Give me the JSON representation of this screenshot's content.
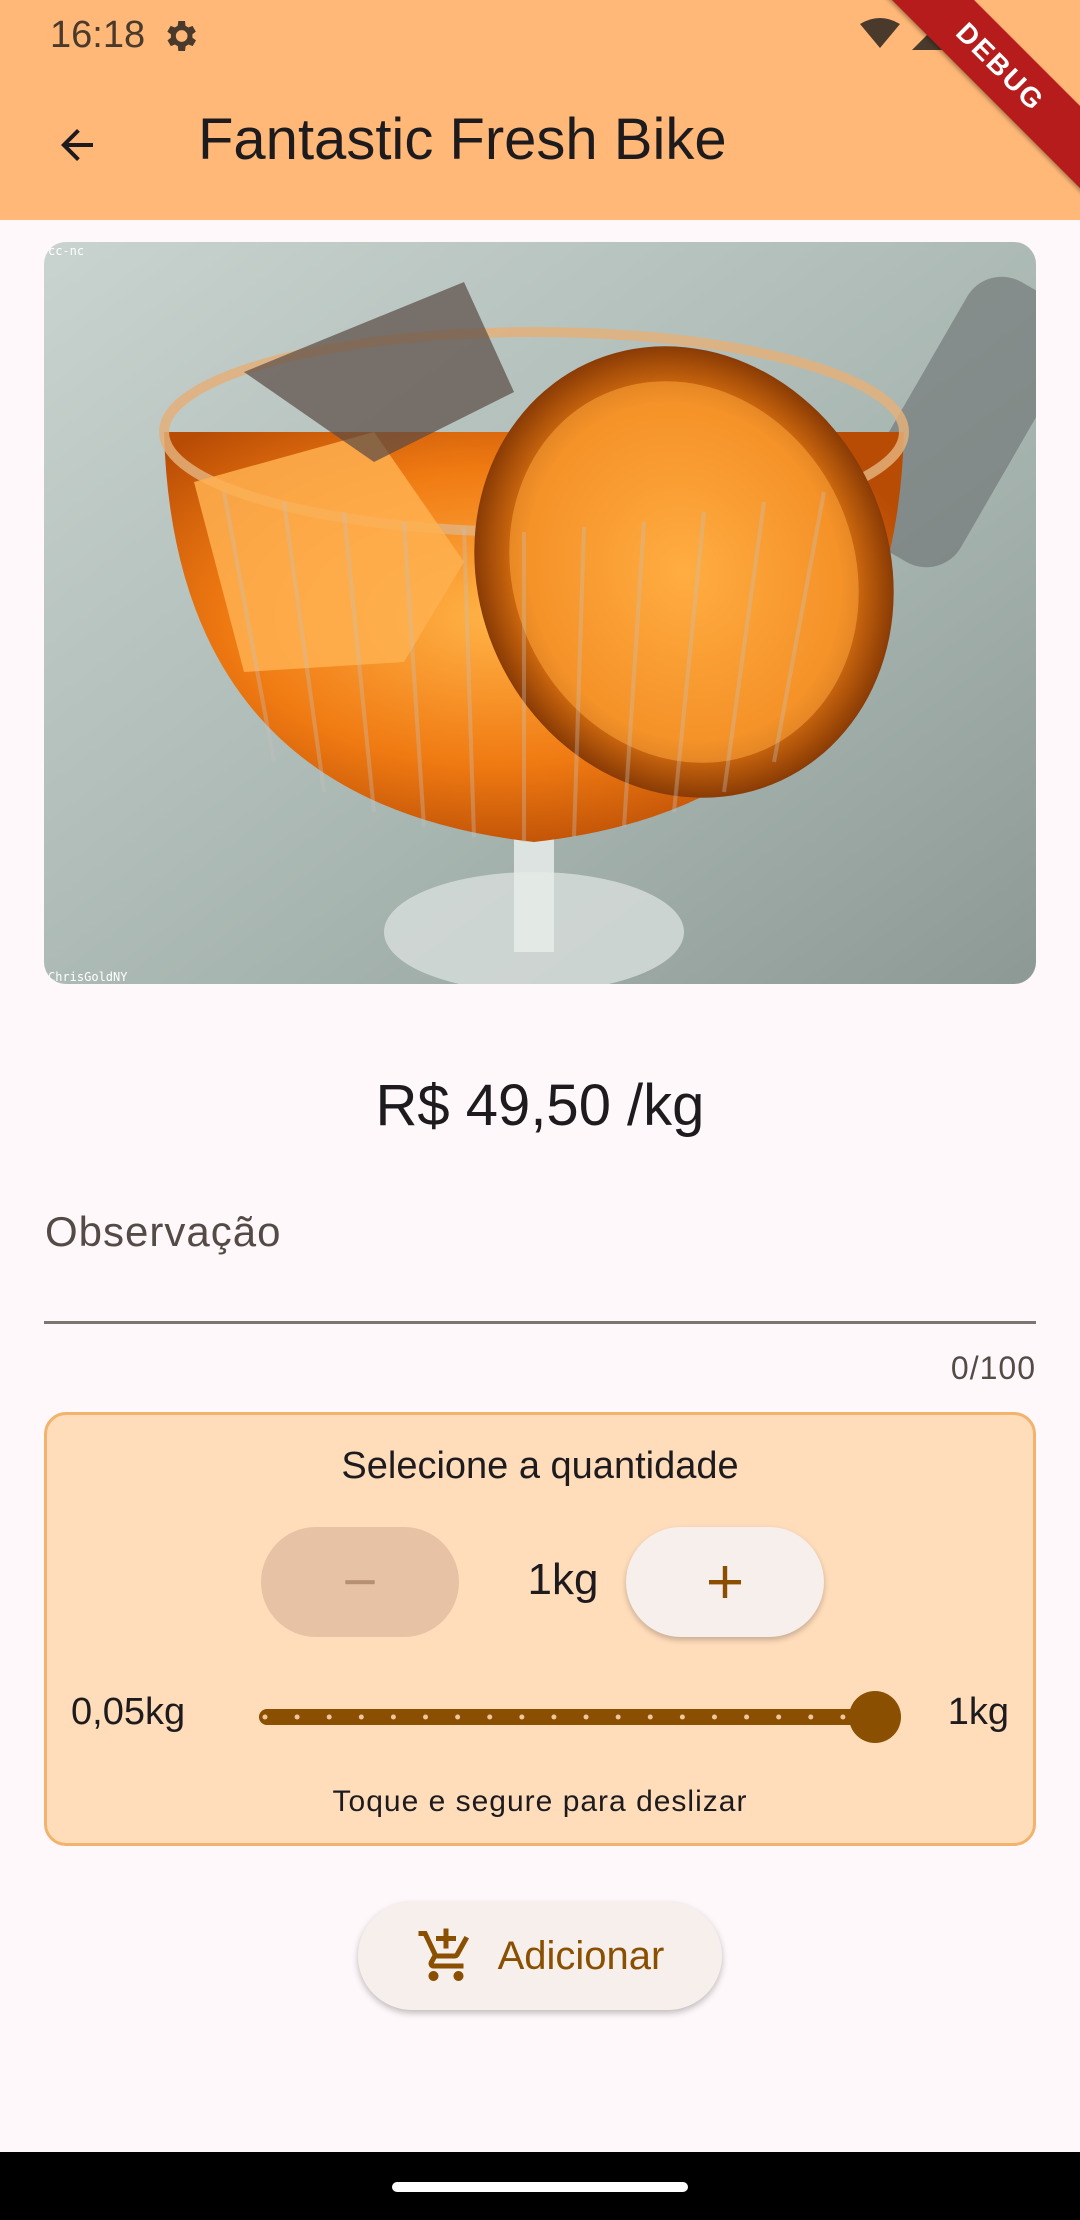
{
  "status_bar": {
    "time": "16:18"
  },
  "debug_banner": "DEBUG",
  "app_bar": {
    "title": "Fantastic Fresh Bike",
    "back_icon": "arrow-back-icon"
  },
  "product_image": {
    "top_tag": "cc-nc",
    "credit": "ChrisGoldNY"
  },
  "price": "R$ 49,50 /kg",
  "observation": {
    "label": "Observação",
    "value": "",
    "counter": "0/100"
  },
  "quantity": {
    "title": "Selecione a quantidade",
    "value_label": "1kg",
    "minus_icon": "minus-icon",
    "plus_icon": "plus-icon",
    "slider": {
      "min_label": "0,05kg",
      "max_label": "1kg",
      "min": 0.05,
      "max": 1,
      "value": 1,
      "divisions": 19
    },
    "hint": "Toque e segure para deslizar"
  },
  "add_button": {
    "label": "Adicionar",
    "icon": "add-shopping-cart-icon"
  },
  "colors": {
    "app_bar": "#ffb877",
    "accent": "#8a4f00",
    "card": "#ffdcba",
    "card_border": "#f2b36c"
  }
}
